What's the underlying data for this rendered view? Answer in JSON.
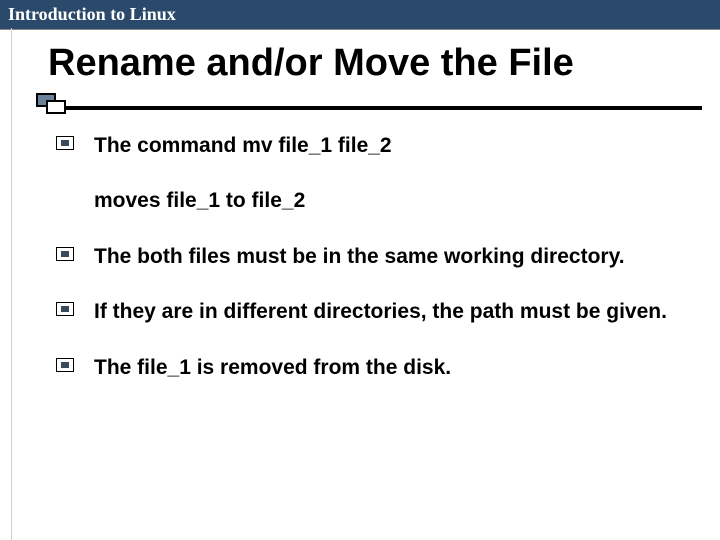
{
  "header": {
    "title": "Introduction to Linux"
  },
  "slide": {
    "title": "Rename and/or Move the File"
  },
  "bullets": [
    {
      "line1": "The command mv file_1 file_2",
      "line2": "moves file_1 to file_2"
    },
    {
      "text": "The both files  must be in the same working directory."
    },
    {
      "text": " If they are in different directories, the path must be given."
    },
    {
      "text": "The file_1 is removed from the disk."
    }
  ]
}
